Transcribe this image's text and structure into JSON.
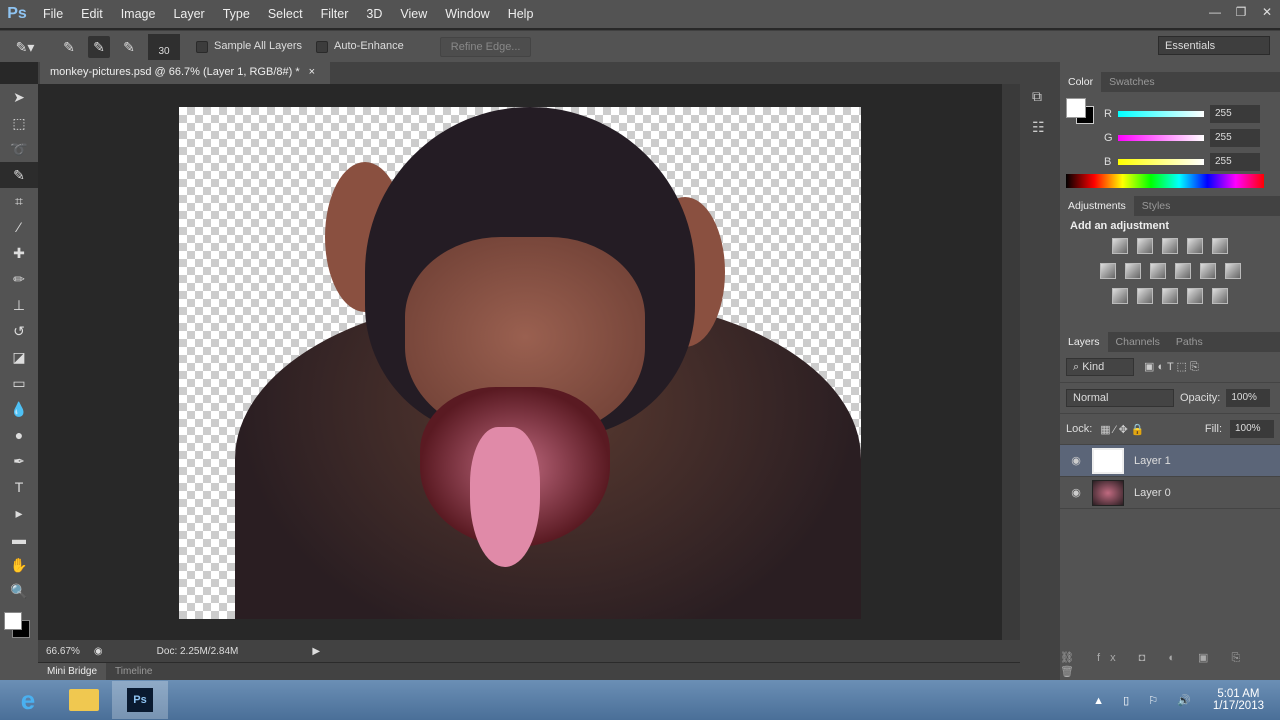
{
  "app": {
    "logo": "Ps",
    "menu": [
      "File",
      "Edit",
      "Image",
      "Layer",
      "Type",
      "Select",
      "Filter",
      "3D",
      "View",
      "Window",
      "Help"
    ]
  },
  "options": {
    "brush_size": "30",
    "sample_all_layers": "Sample All Layers",
    "auto_enhance": "Auto-Enhance",
    "refine_edge": "Refine Edge...",
    "workspace": "Essentials"
  },
  "document": {
    "tab_title": "monkey-pictures.psd @ 66.7% (Layer 1, RGB/8#) *",
    "close": "×"
  },
  "status": {
    "zoom": "66.67%",
    "doc": "Doc: 2.25M/2.84M"
  },
  "bottom_tabs": [
    "Mini Bridge",
    "Timeline"
  ],
  "color_panel": {
    "tabs": [
      "Color",
      "Swatches"
    ],
    "channels": [
      {
        "label": "R",
        "value": "255"
      },
      {
        "label": "G",
        "value": "255"
      },
      {
        "label": "B",
        "value": "255"
      }
    ],
    "foreground": "#ffffff",
    "background": "#000000"
  },
  "adjustments_panel": {
    "tabs": [
      "Adjustments",
      "Styles"
    ],
    "heading": "Add an adjustment"
  },
  "layers_panel": {
    "tabs": [
      "Layers",
      "Channels",
      "Paths"
    ],
    "filter": "Kind",
    "blend_mode": "Normal",
    "opacity_label": "Opacity:",
    "opacity": "100%",
    "lock_label": "Lock:",
    "fill_label": "Fill:",
    "fill": "100%",
    "layers": [
      {
        "name": "Layer 1",
        "selected": true
      },
      {
        "name": "Layer 0",
        "selected": false
      }
    ]
  },
  "taskbar": {
    "time": "5:01 AM",
    "date": "1/17/2013"
  }
}
